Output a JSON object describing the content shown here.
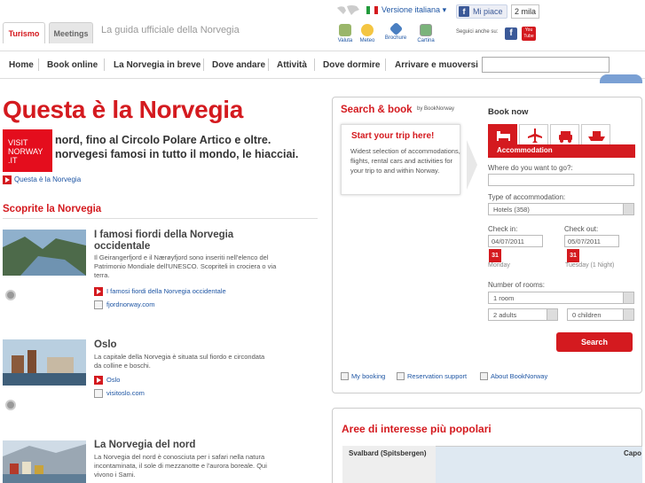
{
  "header": {
    "tabs": [
      "Turismo",
      "Meetings"
    ],
    "tagline": "La guida ufficiale della Norvegia",
    "language": "Versione italiana",
    "fb_like": "Mi piace",
    "fb_count": "2 mila",
    "tools": [
      "Valuta",
      "Meteo",
      "Brochure",
      "Cartina"
    ],
    "follow_label": "Seguici anche su:",
    "youtube_label": "You Tube"
  },
  "nav": {
    "items": [
      "Home",
      "Book online",
      "La Norvegia in breve",
      "Dove andare",
      "Attività",
      "Dove dormire",
      "Arrivare e muoversi"
    ],
    "search_placeholder": ""
  },
  "hero": {
    "title": "Questa è la Norvegia",
    "logo": [
      "VISIT",
      "NORWAY",
      ".IT"
    ],
    "subtitle": "nord, fino al Circolo Polare Artico e oltre. norvegesi famosi in tutto il mondo, le hiacciai.",
    "link": "Questa è la Norvegia"
  },
  "discover": {
    "heading": "Scoprite la Norvegia",
    "articles": [
      {
        "title": "I famosi fiordi della Norvegia occidentale",
        "body": "Il Geirangerfjord e il Nærøyfjord sono inseriti nell'elenco del Patrimonio Mondiale dell'UNESCO. Scopriteli in crociera o via terra.",
        "link": "I famosi fiordi della Norvegia occidentale",
        "ext": "fjordnorway.com"
      },
      {
        "title": "Oslo",
        "body": "La capitale della Norvegia è situata sul fiordo e circondata da colline e boschi.",
        "link": "Oslo",
        "ext": "visitoslo.com"
      },
      {
        "title": "La Norvegia del nord",
        "body": "La Norvegia del nord è conosciuta per i safari nella natura incontaminata, il sole di mezzanotte e l'aurora boreale. Qui vivono i Sami.",
        "link": "",
        "ext": ""
      }
    ]
  },
  "booking": {
    "title": "Search & book",
    "by": "by BookNorway",
    "card_title": "Start your trip here!",
    "card_body": "Widest selection of accommodations, flights, rental cars and activities for your trip to and within Norway.",
    "book_now": "Book now",
    "tab_label": "Accommodation",
    "where_label": "Where do you want to go?:",
    "where_value": "",
    "type_label": "Type of accommodation:",
    "type_value": "Hotels (358)",
    "checkin_label": "Check in:",
    "checkin_value": "04/07/2011",
    "checkin_day": "Monday",
    "checkout_label": "Check out:",
    "checkout_value": "05/07/2011",
    "checkout_day": "Tuesday (1 Night)",
    "cal_day": "31",
    "rooms_label": "Number of rooms:",
    "rooms_value": "1 room",
    "adults_value": "2 adults",
    "children_value": "0 children",
    "search_label": "Search",
    "footer_links": [
      "My booking",
      "Reservation support",
      "About BookNorway"
    ]
  },
  "areas": {
    "title": "Aree di interesse più popolari",
    "map_labels": [
      "Svalbard (Spitsbergen)",
      "Capo"
    ]
  },
  "colors": {
    "brand_red": "#d41a1f",
    "link_blue": "#1f56a4"
  }
}
